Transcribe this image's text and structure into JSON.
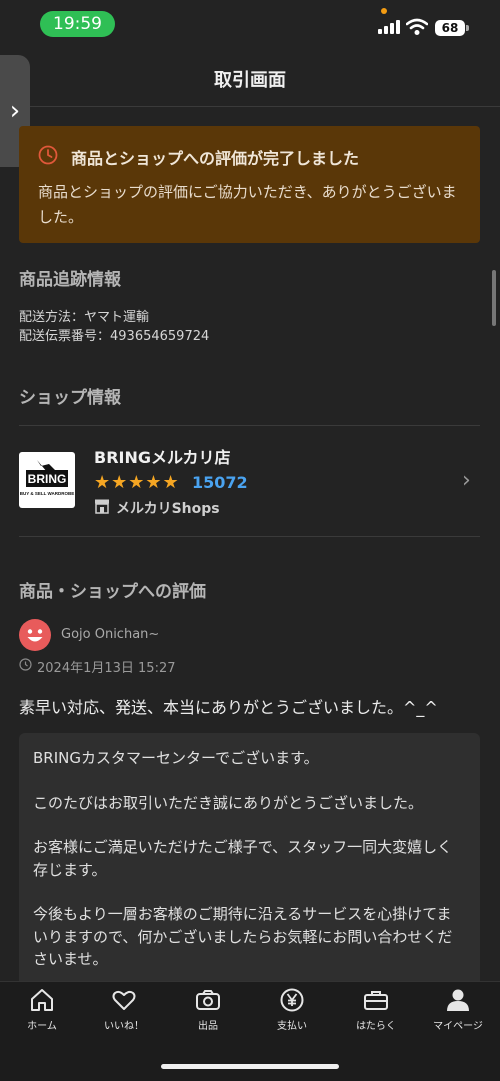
{
  "status_bar": {
    "time": "19:59",
    "battery": "68"
  },
  "header": {
    "title": "取引画面"
  },
  "banner": {
    "title": "商品とショップへの評価が完了しました",
    "message": "商品とショップの評価にご協力いただき、ありがとうございました。",
    "bg_color": "#5a3708"
  },
  "tracking": {
    "title": "商品追跡情報",
    "shipping_method": "配送方法：ヤマト運輸",
    "tracking_number": "配送伝票番号：493654659724"
  },
  "shop": {
    "section_title": "ショップ情報",
    "name": "BRINGメルカリ店",
    "logo_text": "BRING",
    "logo_subtext": "BUY & SELL WARDROBE",
    "stars": "★★★★★",
    "review_count": "15072",
    "badge": "メルカリShops"
  },
  "review": {
    "section_title": "商品・ショップへの評価",
    "reviewer": "Gojo Onichan~",
    "date": "2024年1月13日 15:27",
    "text": "素早い対応、発送、本当にありがとうございました。^_^",
    "reply": {
      "p1": "BRINGカスタマーセンターでございます。",
      "p2": "このたびはお取引いただき誠にありがとうございました。",
      "p3": "お客様にご満足いただけたご様子で、スタッフ一同大変嬉しく存じます。",
      "p4": "今後もより一層お客様のご期待に沿えるサービスを心掛けてまいりますので、何かございましたらお気軽にお問い合わせくださいませ。"
    }
  },
  "tabbar": {
    "home": "ホーム",
    "likes": "いいね！",
    "sell": "出品",
    "pay": "支払い",
    "work": "はたらく",
    "mypage": "マイページ"
  }
}
